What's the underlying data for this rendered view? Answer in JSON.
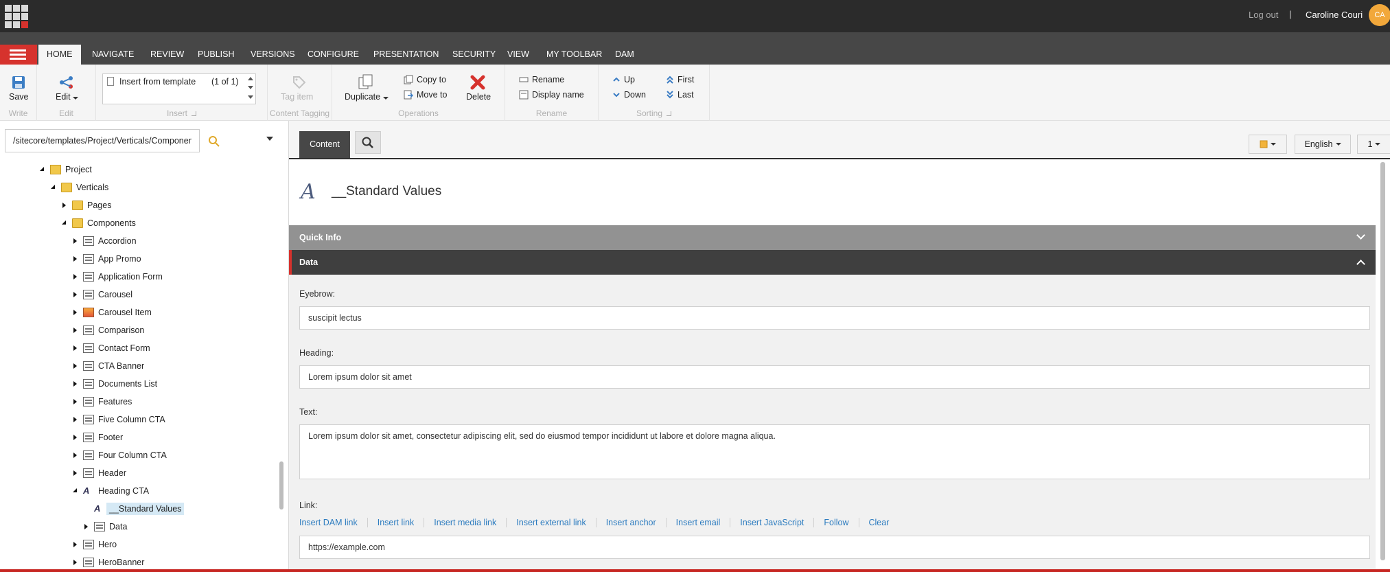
{
  "topbar": {
    "logout": "Log out",
    "separator": "|",
    "user_name": "Caroline Couri",
    "avatar_initials": "CA"
  },
  "ribbon_tabs": [
    "HOME",
    "NAVIGATE",
    "REVIEW",
    "PUBLISH",
    "VERSIONS",
    "CONFIGURE",
    "PRESENTATION",
    "SECURITY",
    "VIEW",
    "MY TOOLBAR",
    "DAM"
  ],
  "active_tab": "HOME",
  "ribbon": {
    "write": {
      "save": "Save",
      "group": "Write"
    },
    "edit": {
      "edit": "Edit",
      "group": "Edit"
    },
    "insert": {
      "item": "Insert from template",
      "count": "(1 of 1)",
      "group": "Insert"
    },
    "tagging": {
      "tag_item": "Tag item",
      "group": "Content Tagging"
    },
    "operations": {
      "duplicate": "Duplicate",
      "copy_to": "Copy to",
      "move_to": "Move to",
      "delete": "Delete",
      "group": "Operations"
    },
    "rename": {
      "rename": "Rename",
      "display_name": "Display name",
      "group": "Rename"
    },
    "sorting": {
      "up": "Up",
      "down": "Down",
      "first": "First",
      "last": "Last",
      "group": "Sorting"
    }
  },
  "search": {
    "path": "/sitecore/templates/Project/Verticals/Components/Heading CTA/__Standard Values"
  },
  "tree": {
    "project": "Project",
    "verticals": "Verticals",
    "pages": "Pages",
    "components": "Components",
    "items": [
      "Accordion",
      "App Promo",
      "Application Form",
      "Carousel",
      "Carousel Item",
      "Comparison",
      "Contact Form",
      "CTA Banner",
      "Documents List",
      "Features",
      "Five Column CTA",
      "Footer",
      "Four Column CTA",
      "Header",
      "Heading CTA"
    ],
    "standard_values": "__Standard Values",
    "data": "Data",
    "after": [
      "Hero",
      "HeroBanner"
    ]
  },
  "editor": {
    "tab_content": "Content",
    "language": "English",
    "version": "1",
    "item_title": "__Standard Values",
    "sections": {
      "quick_info": "Quick Info",
      "data": "Data"
    },
    "fields": {
      "eyebrow_label": "Eyebrow:",
      "eyebrow_value": "suscipit lectus",
      "heading_label": "Heading:",
      "heading_value": "Lorem ipsum dolor sit amet",
      "text_label": "Text:",
      "text_value": "Lorem ipsum dolor sit amet, consectetur adipiscing elit, sed do eiusmod tempor incididunt ut labore et dolore magna aliqua.",
      "link_label": "Link:",
      "link_value": "https://example.com"
    },
    "link_actions": [
      "Insert DAM link",
      "Insert link",
      "Insert media link",
      "Insert external link",
      "Insert anchor",
      "Insert email",
      "Insert JavaScript",
      "Follow",
      "Clear"
    ]
  },
  "colors": {
    "accent_red": "#d6322d",
    "link_blue": "#2b7bbf",
    "dark_bar": "#2b2b2b",
    "avatar": "#f2a83b"
  }
}
